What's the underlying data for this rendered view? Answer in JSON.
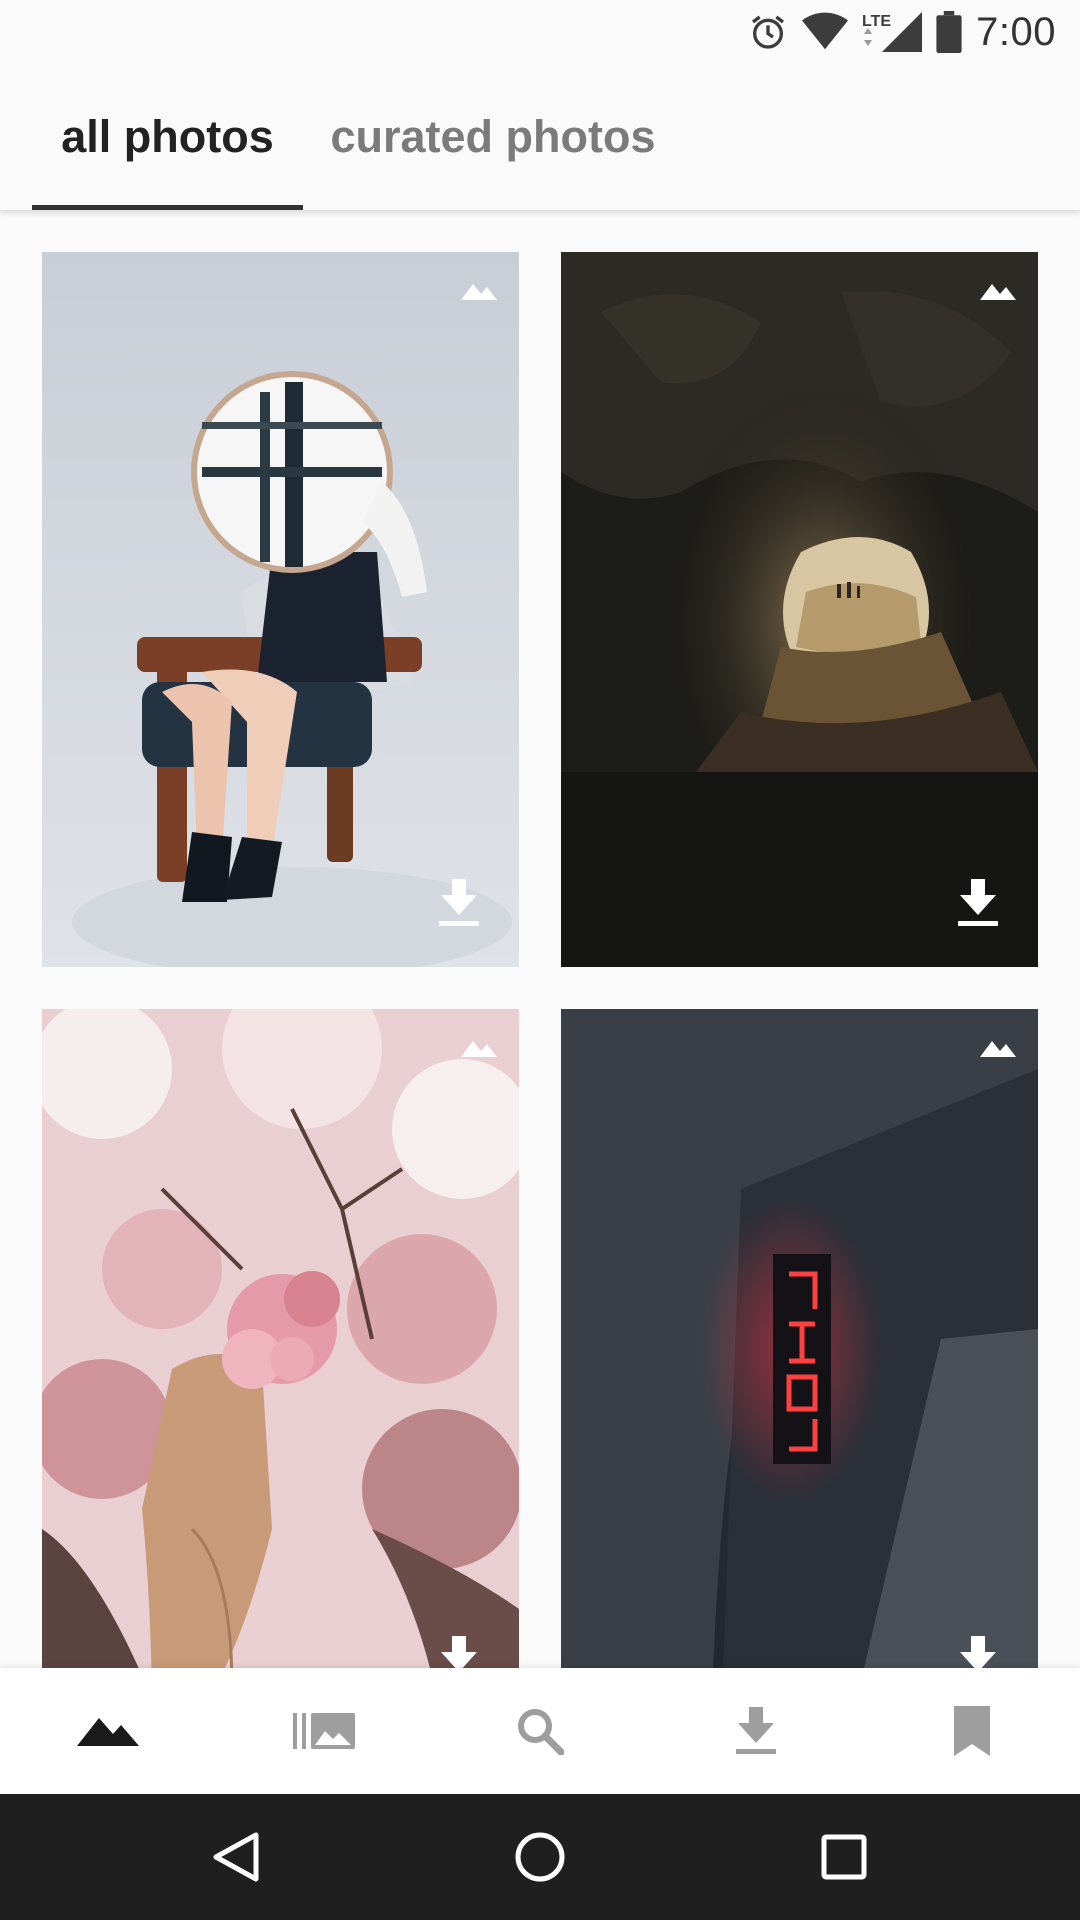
{
  "status_bar": {
    "time": "7:00",
    "network": "LTE",
    "icons": [
      "alarm-icon",
      "wifi-icon",
      "lte-signal-icon",
      "battery-icon"
    ]
  },
  "tabs": [
    {
      "label": "all photos",
      "selected": true
    },
    {
      "label": "curated photos",
      "selected": false
    }
  ],
  "photos": [
    {
      "subject": "person holding round mirror on chair",
      "icons": [
        "mountain-badge-icon",
        "download-icon"
      ]
    },
    {
      "subject": "dark sea cave opening to beach",
      "icons": [
        "mountain-badge-icon",
        "download-icon"
      ]
    },
    {
      "subject": "hand holding pink blossom",
      "icons": [
        "mountain-badge-icon",
        "download-icon"
      ]
    },
    {
      "subject": "neon sign reflection in puddle",
      "icons": [
        "mountain-badge-icon",
        "download-icon"
      ]
    }
  ],
  "bottom_nav": [
    {
      "icon": "mountain-icon",
      "active": true
    },
    {
      "icon": "collections-icon",
      "active": false
    },
    {
      "icon": "search-icon",
      "active": false
    },
    {
      "icon": "download-icon",
      "active": false
    },
    {
      "icon": "bookmark-icon",
      "active": false
    }
  ],
  "system_nav": [
    "back-icon",
    "home-icon",
    "recents-icon"
  ],
  "colors": {
    "active_tab_text": "#222222",
    "inactive_tab_text": "#7b7b7b",
    "active_nav_icon": "#1a1a1a",
    "inactive_nav_icon": "#9e9e9e",
    "system_nav_bg": "#1f1f1f"
  }
}
